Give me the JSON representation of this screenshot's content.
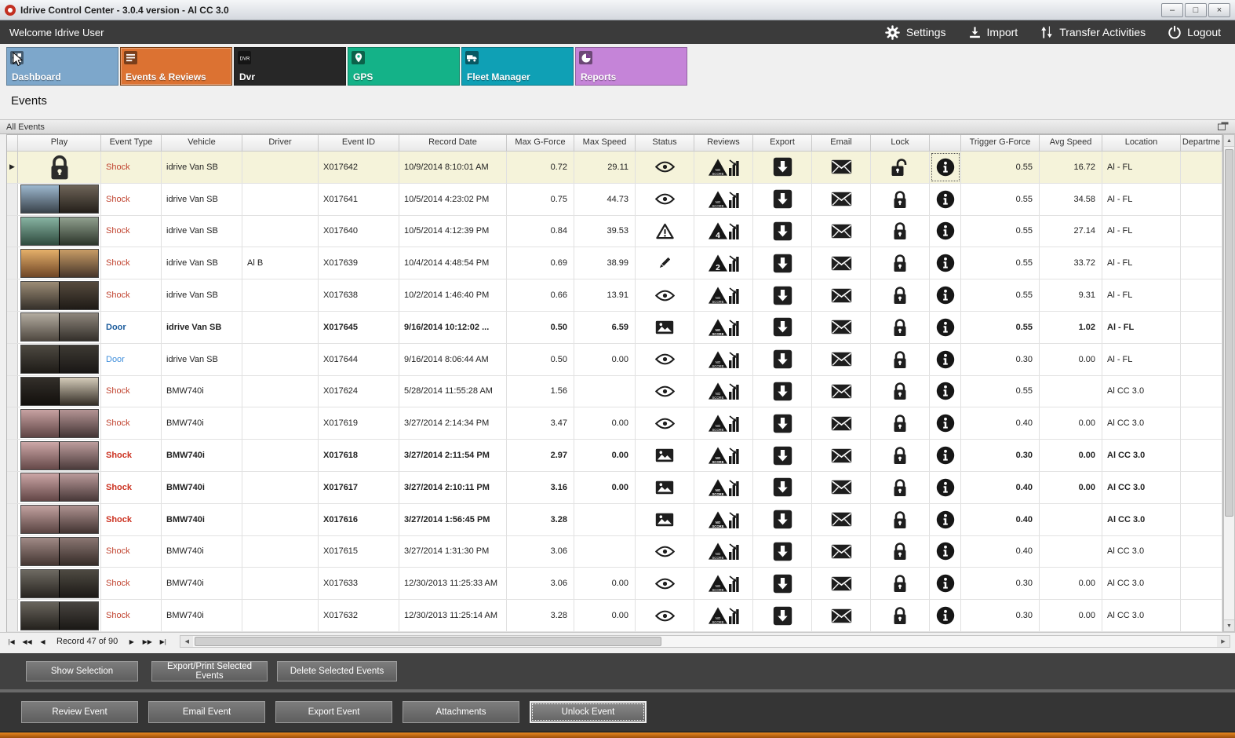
{
  "window": {
    "title": "Idrive Control Center - 3.0.4 version - Al CC 3.0",
    "minimize": "–",
    "maximize": "□",
    "close": "×"
  },
  "topbar": {
    "welcome": "Welcome Idrive User",
    "actions": [
      {
        "label": "Settings",
        "icon": "gear-icon"
      },
      {
        "label": "Import",
        "icon": "import-icon"
      },
      {
        "label": "Transfer Activities",
        "icon": "transfer-icon"
      },
      {
        "label": "Logout",
        "icon": "power-icon"
      }
    ]
  },
  "tabs": [
    {
      "label": "Dashboard",
      "color": "#7da7cb",
      "selected": false
    },
    {
      "label": "Events & Reviews",
      "color": "#dc7232",
      "selected": true
    },
    {
      "label": "Dvr",
      "color": "#272727",
      "selected": false
    },
    {
      "label": "GPS",
      "color": "#14b288",
      "selected": false
    },
    {
      "label": "Fleet Manager",
      "color": "#0fa0b5",
      "selected": false
    },
    {
      "label": "Reports",
      "color": "#c584d8",
      "selected": false
    }
  ],
  "page_title": "Events",
  "group_header": "All Events",
  "grid": {
    "columns": [
      "",
      "Play",
      "Event Type",
      "Vehicle",
      "Driver",
      "Event ID",
      "Record Date",
      "Max G-Force",
      "Max Speed",
      "Status",
      "Reviews",
      "Export",
      "Email",
      "Lock",
      "",
      "Trigger G-Force",
      "Avg Speed",
      "Location",
      "Departme"
    ],
    "rows": [
      {
        "selected": true,
        "bold": false,
        "play": "lock",
        "thumb": null,
        "event_type": "Shock",
        "type_color": "#c0432f",
        "vehicle": "idrive Van SB",
        "driver": "",
        "event_id": "X017642",
        "record_date": "10/9/2014 8:10:01 AM",
        "max_g": "0.72",
        "max_speed": "29.11",
        "status": "eye",
        "review": "NO SCORE",
        "lock": "unlocked",
        "trigger_g": "0.55",
        "avg_speed": "16.72",
        "location": "Al - FL"
      },
      {
        "selected": false,
        "bold": false,
        "play": "thumb",
        "thumb": [
          "#9db8cf",
          "#39424a",
          "#6e6458",
          "#241f1a"
        ],
        "event_type": "Shock",
        "type_color": "#c0432f",
        "vehicle": "idrive Van SB",
        "driver": "",
        "event_id": "X017641",
        "record_date": "10/5/2014 4:23:02 PM",
        "max_g": "0.75",
        "max_speed": "44.73",
        "status": "eye",
        "review": "NO SCORE",
        "lock": "locked",
        "trigger_g": "0.55",
        "avg_speed": "34.58",
        "location": "Al - FL"
      },
      {
        "selected": false,
        "bold": false,
        "play": "thumb",
        "thumb": [
          "#87b3a2",
          "#2f4a3e",
          "#90a08e",
          "#2c352a"
        ],
        "event_type": "Shock",
        "type_color": "#c0432f",
        "vehicle": "idrive Van SB",
        "driver": "",
        "event_id": "X017640",
        "record_date": "10/5/2014 4:12:39 PM",
        "max_g": "0.84",
        "max_speed": "39.53",
        "status": "warning",
        "review": "4",
        "lock": "locked",
        "trigger_g": "0.55",
        "avg_speed": "27.14",
        "location": "Al - FL"
      },
      {
        "selected": false,
        "bold": false,
        "play": "thumb",
        "thumb": [
          "#e5b06a",
          "#6e4526",
          "#c89c66",
          "#46352a"
        ],
        "event_type": "Shock",
        "type_color": "#c0432f",
        "vehicle": "idrive Van SB",
        "driver": "Al B",
        "event_id": "X017639",
        "record_date": "10/4/2014 4:48:54 PM",
        "max_g": "0.69",
        "max_speed": "38.99",
        "status": "pencil",
        "review": "2",
        "lock": "locked",
        "trigger_g": "0.55",
        "avg_speed": "33.72",
        "location": "Al - FL"
      },
      {
        "selected": false,
        "bold": false,
        "play": "thumb",
        "thumb": [
          "#9c8c76",
          "#35302a",
          "#564b3e",
          "#1e1a16"
        ],
        "event_type": "Shock",
        "type_color": "#c0432f",
        "vehicle": "idrive Van SB",
        "driver": "",
        "event_id": "X017638",
        "record_date": "10/2/2014 1:46:40 PM",
        "max_g": "0.66",
        "max_speed": "13.91",
        "status": "eye",
        "review": "NO SCORE",
        "lock": "locked",
        "trigger_g": "0.55",
        "avg_speed": "9.31",
        "location": "Al - FL"
      },
      {
        "selected": false,
        "bold": true,
        "play": "thumb",
        "thumb": [
          "#b3aca0",
          "#4f4840",
          "#8e867c",
          "#332f2a"
        ],
        "event_type": "Door",
        "type_color": "#1c5c9c",
        "vehicle": "idrive Van SB",
        "driver": "",
        "event_id": "X017645",
        "record_date": "9/16/2014 10:12:02 ...",
        "max_g": "0.50",
        "max_speed": "6.59",
        "status": "image",
        "review": "NO SCORE",
        "lock": "locked",
        "trigger_g": "0.55",
        "avg_speed": "1.02",
        "location": "Al - FL"
      },
      {
        "selected": false,
        "bold": false,
        "play": "thumb",
        "thumb": [
          "#4d4941",
          "#1e1b17",
          "#3d3933",
          "#191715"
        ],
        "event_type": "Door",
        "type_color": "#3f8edb",
        "vehicle": "idrive Van SB",
        "driver": "",
        "event_id": "X017644",
        "record_date": "9/16/2014 8:06:44 AM",
        "max_g": "0.50",
        "max_speed": "0.00",
        "status": "eye",
        "review": "NO SCORE",
        "lock": "locked",
        "trigger_g": "0.30",
        "avg_speed": "0.00",
        "location": "Al - FL"
      },
      {
        "selected": false,
        "bold": false,
        "play": "thumb",
        "thumb": [
          "#332f2a",
          "#120f0c",
          "#d5ccba",
          "#342e26"
        ],
        "event_type": "Shock",
        "type_color": "#c0432f",
        "vehicle": "BMW740i",
        "driver": "",
        "event_id": "X017624",
        "record_date": "5/28/2014 11:55:28 AM",
        "max_g": "1.56",
        "max_speed": "",
        "status": "eye",
        "review": "NO SCORE",
        "lock": "locked",
        "trigger_g": "0.55",
        "avg_speed": "",
        "location": "Al CC 3.0"
      },
      {
        "selected": false,
        "bold": false,
        "play": "thumb",
        "thumb": [
          "#c7a2a2",
          "#5e4444",
          "#b49494",
          "#433434"
        ],
        "event_type": "Shock",
        "type_color": "#c0432f",
        "vehicle": "BMW740i",
        "driver": "",
        "event_id": "X017619",
        "record_date": "3/27/2014 2:14:34 PM",
        "max_g": "3.47",
        "max_speed": "0.00",
        "status": "eye",
        "review": "NO SCORE",
        "lock": "locked",
        "trigger_g": "0.40",
        "avg_speed": "0.00",
        "location": "Al CC 3.0"
      },
      {
        "selected": false,
        "bold": true,
        "play": "thumb",
        "thumb": [
          "#cda8a8",
          "#654848",
          "#bd9d9d",
          "#4a3a3a"
        ],
        "event_type": "Shock",
        "type_color": "#cc3322",
        "vehicle": "BMW740i",
        "driver": "",
        "event_id": "X017618",
        "record_date": "3/27/2014 2:11:54 PM",
        "max_g": "2.97",
        "max_speed": "0.00",
        "status": "image",
        "review": "NO SCORE",
        "lock": "locked",
        "trigger_g": "0.30",
        "avg_speed": "0.00",
        "location": "Al CC 3.0"
      },
      {
        "selected": false,
        "bold": true,
        "play": "thumb",
        "thumb": [
          "#cba6a6",
          "#624646",
          "#ba9a9a",
          "#483838"
        ],
        "event_type": "Shock",
        "type_color": "#cc3322",
        "vehicle": "BMW740i",
        "driver": "",
        "event_id": "X017617",
        "record_date": "3/27/2014 2:10:11 PM",
        "max_g": "3.16",
        "max_speed": "0.00",
        "status": "image",
        "review": "NO SCORE",
        "lock": "locked",
        "trigger_g": "0.40",
        "avg_speed": "0.00",
        "location": "Al CC 3.0"
      },
      {
        "selected": false,
        "bold": true,
        "play": "thumb",
        "thumb": [
          "#c2a2a0",
          "#5a4442",
          "#ae9290",
          "#423432"
        ],
        "event_type": "Shock",
        "type_color": "#cc3322",
        "vehicle": "BMW740i",
        "driver": "",
        "event_id": "X017616",
        "record_date": "3/27/2014 1:56:45 PM",
        "max_g": "3.28",
        "max_speed": "",
        "status": "image",
        "review": "NO SCORE",
        "lock": "locked",
        "trigger_g": "0.40",
        "avg_speed": "",
        "location": "Al CC 3.0"
      },
      {
        "selected": false,
        "bold": false,
        "play": "thumb",
        "thumb": [
          "#a08a86",
          "#443632",
          "#8a7672",
          "#362c28"
        ],
        "event_type": "Shock",
        "type_color": "#c0432f",
        "vehicle": "BMW740i",
        "driver": "",
        "event_id": "X017615",
        "record_date": "3/27/2014 1:31:30 PM",
        "max_g": "3.06",
        "max_speed": "",
        "status": "eye",
        "review": "NO SCORE",
        "lock": "locked",
        "trigger_g": "0.40",
        "avg_speed": "",
        "location": "Al CC 3.0"
      },
      {
        "selected": false,
        "bold": false,
        "play": "thumb",
        "thumb": [
          "#6e6a62",
          "#282420",
          "#4e4a42",
          "#1c1916"
        ],
        "event_type": "Shock",
        "type_color": "#c0432f",
        "vehicle": "BMW740i",
        "driver": "",
        "event_id": "X017633",
        "record_date": "12/30/2013 11:25:33 AM",
        "max_g": "3.06",
        "max_speed": "0.00",
        "status": "eye",
        "review": "NO SCORE",
        "lock": "locked",
        "trigger_g": "0.30",
        "avg_speed": "0.00",
        "location": "Al CC 3.0"
      },
      {
        "selected": false,
        "bold": false,
        "play": "thumb",
        "thumb": [
          "#68645c",
          "#24211d",
          "#484440",
          "#1a1815"
        ],
        "event_type": "Shock",
        "type_color": "#c0432f",
        "vehicle": "BMW740i",
        "driver": "",
        "event_id": "X017632",
        "record_date": "12/30/2013 11:25:14 AM",
        "max_g": "3.28",
        "max_speed": "0.00",
        "status": "eye",
        "review": "NO SCORE",
        "lock": "locked",
        "trigger_g": "0.30",
        "avg_speed": "0.00",
        "location": "Al CC 3.0"
      }
    ]
  },
  "pager": {
    "record_text": "Record 47 of 90"
  },
  "selection_bar": {
    "buttons": [
      "Show Selection",
      "Export/Print Selected Events",
      "Delete Selected  Events"
    ]
  },
  "event_bar": {
    "buttons": [
      "Review Event",
      "Email Event",
      "Export Event",
      "Attachments",
      "Unlock Event"
    ],
    "focused": "Unlock Event"
  }
}
